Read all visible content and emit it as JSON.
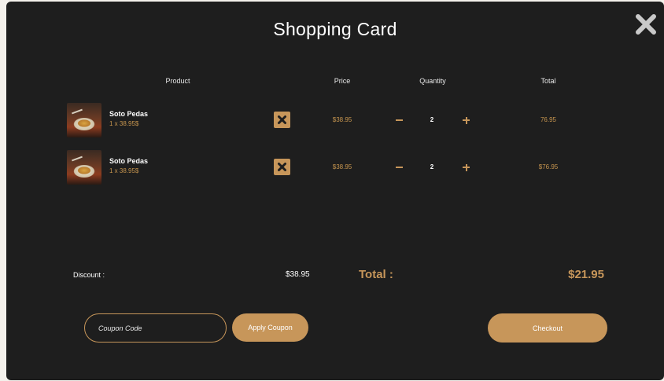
{
  "modal": {
    "title": "Shopping Card",
    "close_icon": "close-x-icon"
  },
  "table": {
    "headers": {
      "product": "Product",
      "price": "Price",
      "quantity": "Quantity",
      "total": "Total"
    },
    "rows": [
      {
        "name": "Soto Pedas",
        "subline": "1 x 38.95$",
        "price": "$38.95",
        "quantity": "2",
        "total": "76.95"
      },
      {
        "name": "Soto Pedas",
        "subline": "1 x 38.95$",
        "price": "$38.95",
        "quantity": "2",
        "total": "$76.95"
      }
    ]
  },
  "summary": {
    "discount_label": "Discount :",
    "discount_value": "$38.95",
    "total_label": "Total :",
    "total_value": "$21.95"
  },
  "coupon": {
    "placeholder": "Coupon Code",
    "apply_label": "Apply Coupon"
  },
  "checkout": {
    "label": "Checkout"
  },
  "colors": {
    "accent": "#c7965a",
    "background": "#1e1e1e",
    "page": "#f4f1ec"
  }
}
